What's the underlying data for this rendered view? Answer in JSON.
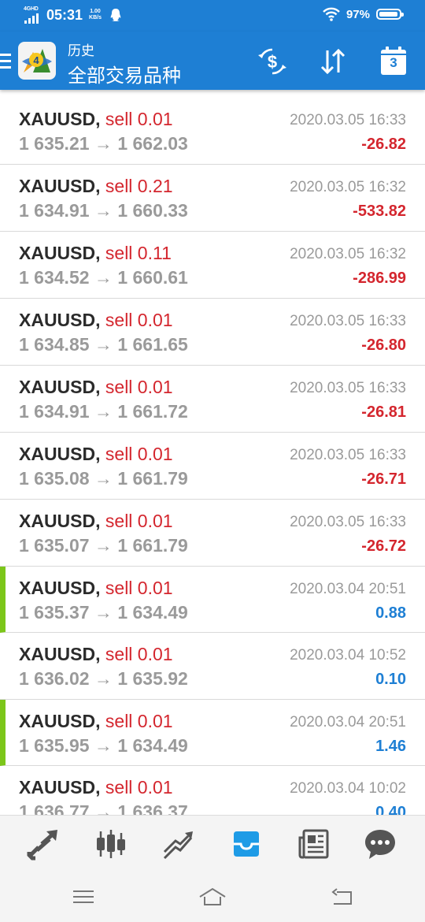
{
  "status_bar": {
    "network": "4GHD",
    "time": "05:31",
    "net_speed_value": "1.00",
    "net_speed_unit": "KB/s",
    "battery": "97%",
    "icons": [
      "signal-icon",
      "qq-icon",
      "wifi-icon",
      "battery-icon"
    ]
  },
  "header": {
    "subtitle": "历史",
    "title": "全部交易品种",
    "calendar_number": "3",
    "icons": [
      "menu-icon",
      "metatrader-logo",
      "currency-exchange-icon",
      "sort-icon",
      "calendar-icon"
    ]
  },
  "colors": {
    "primary": "#1e7fd4",
    "loss": "#d4262e",
    "gain": "#1e7fd4",
    "marker": "#7cc61a"
  },
  "trades": [
    {
      "symbol": "XAUUSD,",
      "side": "sell 0.01",
      "open": "1 635.21",
      "arrow": "→",
      "close": "1 662.03",
      "time": "2020.03.05 16:33",
      "profit": "-26.82",
      "sign": "neg",
      "marked": false
    },
    {
      "symbol": "XAUUSD,",
      "side": "sell 0.21",
      "open": "1 634.91",
      "arrow": "→",
      "close": "1 660.33",
      "time": "2020.03.05 16:32",
      "profit": "-533.82",
      "sign": "neg",
      "marked": false
    },
    {
      "symbol": "XAUUSD,",
      "side": "sell 0.11",
      "open": "1 634.52",
      "arrow": "→",
      "close": "1 660.61",
      "time": "2020.03.05 16:32",
      "profit": "-286.99",
      "sign": "neg",
      "marked": false
    },
    {
      "symbol": "XAUUSD,",
      "side": "sell 0.01",
      "open": "1 634.85",
      "arrow": "→",
      "close": "1 661.65",
      "time": "2020.03.05 16:33",
      "profit": "-26.80",
      "sign": "neg",
      "marked": false
    },
    {
      "symbol": "XAUUSD,",
      "side": "sell 0.01",
      "open": "1 634.91",
      "arrow": "→",
      "close": "1 661.72",
      "time": "2020.03.05 16:33",
      "profit": "-26.81",
      "sign": "neg",
      "marked": false
    },
    {
      "symbol": "XAUUSD,",
      "side": "sell 0.01",
      "open": "1 635.08",
      "arrow": "→",
      "close": "1 661.79",
      "time": "2020.03.05 16:33",
      "profit": "-26.71",
      "sign": "neg",
      "marked": false
    },
    {
      "symbol": "XAUUSD,",
      "side": "sell 0.01",
      "open": "1 635.07",
      "arrow": "→",
      "close": "1 661.79",
      "time": "2020.03.05 16:33",
      "profit": "-26.72",
      "sign": "neg",
      "marked": false
    },
    {
      "symbol": "XAUUSD,",
      "side": "sell 0.01",
      "open": "1 635.37",
      "arrow": "→",
      "close": "1 634.49",
      "time": "2020.03.04 20:51",
      "profit": "0.88",
      "sign": "pos",
      "marked": true
    },
    {
      "symbol": "XAUUSD,",
      "side": "sell 0.01",
      "open": "1 636.02",
      "arrow": "→",
      "close": "1 635.92",
      "time": "2020.03.04 10:52",
      "profit": "0.10",
      "sign": "pos",
      "marked": false
    },
    {
      "symbol": "XAUUSD,",
      "side": "sell 0.01",
      "open": "1 635.95",
      "arrow": "→",
      "close": "1 634.49",
      "time": "2020.03.04 20:51",
      "profit": "1.46",
      "sign": "pos",
      "marked": true
    },
    {
      "symbol": "XAUUSD,",
      "side": "sell 0.01",
      "open": "1 636.77",
      "arrow": "→",
      "close": "1 636.37",
      "time": "2020.03.04 10:02",
      "profit": "0.40",
      "sign": "pos",
      "marked": false
    }
  ],
  "bottom_nav": {
    "active": "history",
    "items": [
      "quotes-icon",
      "chart-icon",
      "trade-icon",
      "history-icon",
      "news-icon",
      "chat-icon"
    ]
  },
  "system_nav": {
    "items": [
      "recent-apps-icon",
      "home-icon",
      "back-icon"
    ]
  }
}
